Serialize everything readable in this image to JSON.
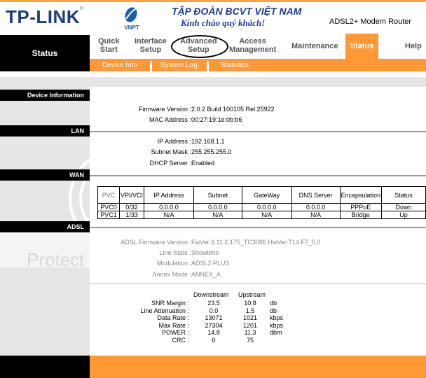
{
  "header": {
    "brand": "TP-LINK",
    "partner_logo_text": "VNPT",
    "slogan_line1": "TẬP ĐOÀN BCVT VIỆT NAM",
    "slogan_line2": "Kính chào quý khách!",
    "model": "ADSL2+ Modem Router"
  },
  "nav": {
    "section_title": "Status",
    "items": [
      {
        "line1": "Quick",
        "line2": "Start"
      },
      {
        "line1": "Interface",
        "line2": "Setup"
      },
      {
        "line1": "Advanced",
        "line2": "Setup"
      },
      {
        "line1": "Access",
        "line2": "Management"
      },
      {
        "line1": "Maintenance",
        "line2": ""
      },
      {
        "line1": "Status",
        "line2": "",
        "active": true
      },
      {
        "line1": "Help",
        "line2": ""
      }
    ],
    "subitems": [
      "Device Info",
      "System Log",
      "Statistics"
    ],
    "accent_color": "#fe9935"
  },
  "sidebar": {
    "sections": [
      "Device Information",
      "LAN",
      "WAN",
      "ADSL"
    ],
    "watermark": "Protect"
  },
  "device_info": {
    "firmware_label": "Firmware Version :",
    "firmware_value": "2.0.2 Build 100105 Rel.25922",
    "mac_label": "MAC Address :",
    "mac_value": "00:27:19:1e:0b:b6"
  },
  "lan": {
    "ip_label": "IP Address :",
    "ip_value": "192.168.1.1",
    "mask_label": "Subnet Mask :",
    "mask_value": "255.255.255.0",
    "dhcp_label": "DHCP Server :",
    "dhcp_value": "Enabled"
  },
  "wan": {
    "columns": [
      "PVC",
      "VPI/VCI",
      "IP Address",
      "Subnet",
      "GateWay",
      "DNS Server",
      "Encapsulation",
      "Status"
    ],
    "rows": [
      [
        "PVC0",
        "0/32",
        "0.0.0.0",
        "0.0.0.0",
        "0.0.0.0",
        "0.0.0.0",
        "PPPoE",
        "Down"
      ],
      [
        "PVC1",
        "1/33",
        "N/A",
        "N/A",
        "N/A",
        "N/A",
        "Bridge",
        "Up"
      ]
    ]
  },
  "adsl": {
    "fw_label": "ADSL Firmware Version :",
    "fw_value": "FwVer:3.11.2.175_TC3086 HwVer:T14.F7_5.0",
    "line_label": "Line State :",
    "line_value": "Showtime",
    "mod_label": "Modulation :",
    "mod_value": "ADSL2 PLUS",
    "annex_label": "Annex Mode :",
    "annex_value": "ANNEX_A",
    "stats_headers": [
      "Downstream",
      "Upstream"
    ],
    "stats": [
      {
        "label": "SNR Margin :",
        "down": "23.5",
        "up": "10.8",
        "unit": "db"
      },
      {
        "label": "Line Attenuation :",
        "down": "0.0",
        "up": "1.5",
        "unit": "db"
      },
      {
        "label": "Data Rate :",
        "down": "13071",
        "up": "1021",
        "unit": "kbps"
      },
      {
        "label": "Max Rate :",
        "down": "27304",
        "up": "1201",
        "unit": "kbps"
      },
      {
        "label": "POWER :",
        "down": "14.8",
        "up": "11.3",
        "unit": "dbm"
      },
      {
        "label": "CRC :",
        "down": "0",
        "up": "75",
        "unit": ""
      }
    ]
  }
}
